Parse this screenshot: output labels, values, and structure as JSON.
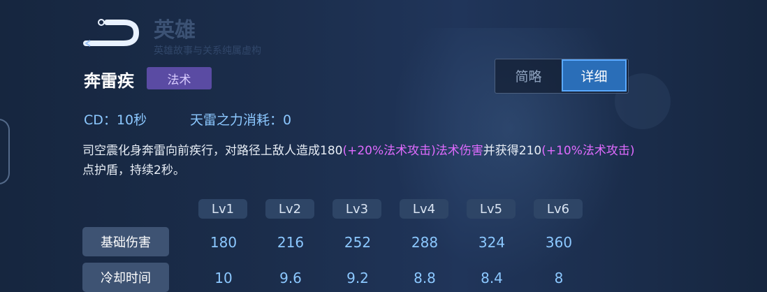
{
  "header": {
    "title": "英雄",
    "subtitle": "英雄故事与关系纯属虚构"
  },
  "skill": {
    "name": "奔雷疾",
    "tag": "法术",
    "cd": "CD：10秒",
    "cost": "天雷之力消耗：0",
    "description": {
      "part1": "司空震化身奔雷向前疾行，对路径上敌人造成180",
      "hl1": "(+20%法术攻击)",
      "part2": "法术伤害",
      "part3": "并获得210",
      "hl2": "(+10%法术攻击)",
      "part4": "点护盾，持续2秒。"
    }
  },
  "toggle": {
    "brief": "简略",
    "detail": "详细"
  },
  "levels": [
    "Lv1",
    "Lv2",
    "Lv3",
    "Lv4",
    "Lv5",
    "Lv6"
  ],
  "rows": [
    {
      "label": "基础伤害",
      "values": [
        "180",
        "216",
        "252",
        "288",
        "324",
        "360"
      ]
    },
    {
      "label": "冷却时间",
      "values": [
        "10",
        "9.6",
        "9.2",
        "8.8",
        "8.4",
        "8"
      ]
    }
  ],
  "colors": {
    "accent": "#2a6eb8",
    "highlight": "#e06bff",
    "tag": "#5a4ba3"
  }
}
